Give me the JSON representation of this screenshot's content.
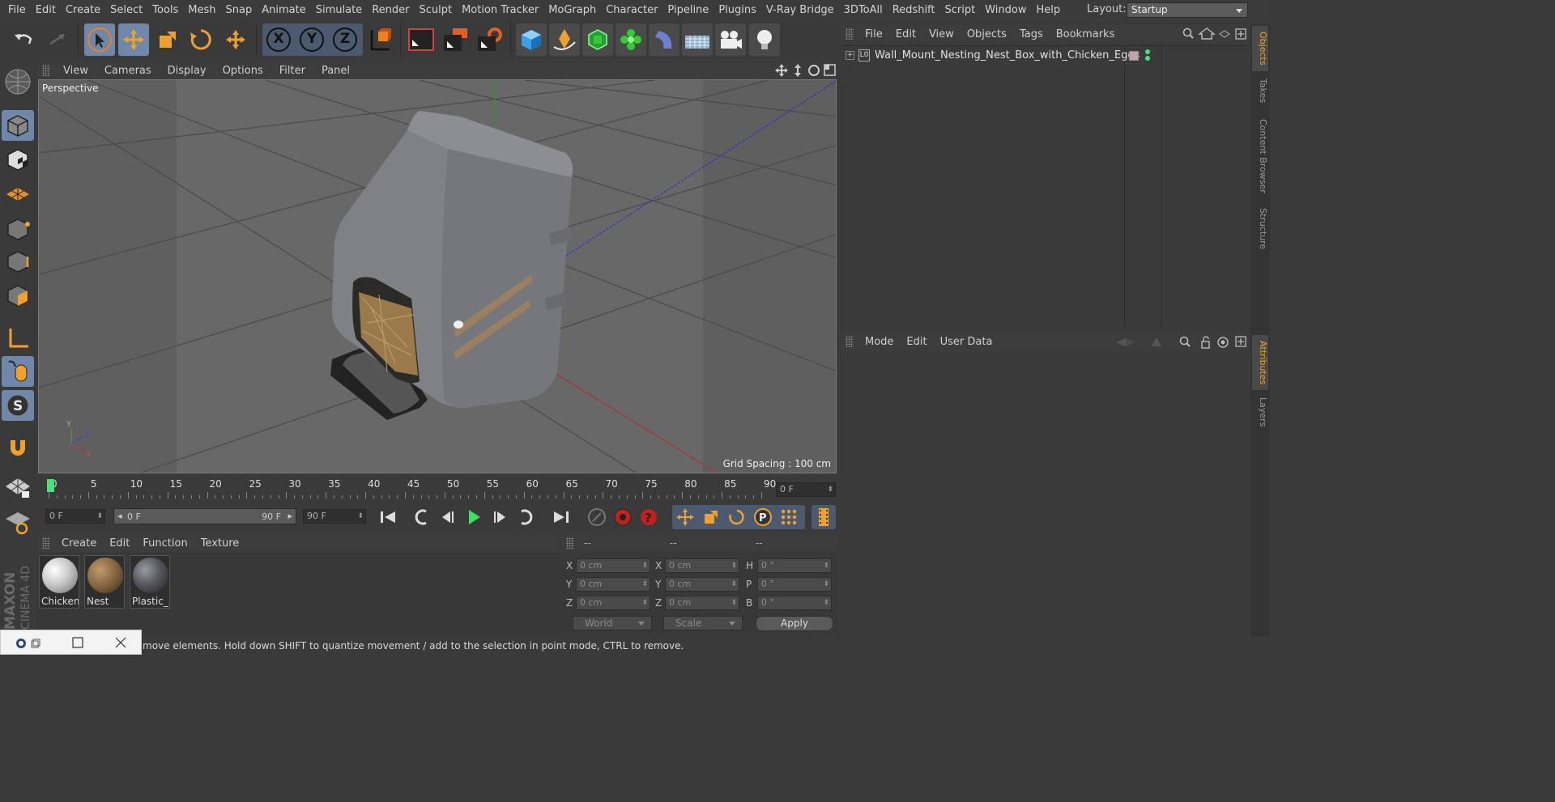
{
  "menubar": {
    "items": [
      "File",
      "Edit",
      "Create",
      "Select",
      "Tools",
      "Mesh",
      "Snap",
      "Animate",
      "Simulate",
      "Render",
      "Sculpt",
      "Motion Tracker",
      "MoGraph",
      "Character",
      "Pipeline",
      "Plugins",
      "V-Ray Bridge",
      "3DToAll",
      "Redshift",
      "Script",
      "Window",
      "Help"
    ],
    "layout_label": "Layout:",
    "layout_value": "Startup"
  },
  "toolbar": {
    "axis_x": "X",
    "axis_y": "Y",
    "axis_z": "Z"
  },
  "viewport": {
    "menu": [
      "View",
      "Cameras",
      "Display",
      "Options",
      "Filter",
      "Panel"
    ],
    "label": "Perspective",
    "grid_spacing": "Grid Spacing : 100 cm",
    "axis_x": "X",
    "axis_y": "Y",
    "axis_z": "Z"
  },
  "timeline": {
    "ticks": [
      "0",
      "5",
      "10",
      "15",
      "20",
      "25",
      "30",
      "35",
      "40",
      "45",
      "50",
      "55",
      "60",
      "65",
      "70",
      "75",
      "80",
      "85",
      "90"
    ],
    "current_frame": "0 F"
  },
  "controls": {
    "start_field": "0 F",
    "range_start": "0 F",
    "range_end": "90 F",
    "end_field": "90 F"
  },
  "materials": {
    "menu": [
      "Create",
      "Edit",
      "Function",
      "Texture"
    ],
    "items": [
      {
        "name": "Chicken",
        "color": "#d8d8d8"
      },
      {
        "name": "Nest",
        "color": "#8a6a45"
      },
      {
        "name": "Plastic_E",
        "color": "#55575c"
      }
    ]
  },
  "coords": {
    "headers": [
      "--",
      "--",
      "--"
    ],
    "pos": {
      "x": "0 cm",
      "y": "0 cm",
      "z": "0 cm"
    },
    "size": {
      "x": "0 cm",
      "y": "0 cm",
      "z": "0 cm"
    },
    "rot": {
      "h": "0 °",
      "p": "0 °",
      "b": "0 °"
    },
    "labels": {
      "x": "X",
      "y": "Y",
      "z": "Z",
      "h": "H",
      "p": "P",
      "b": "B"
    },
    "world": "World",
    "scale": "Scale",
    "apply": "Apply"
  },
  "objects": {
    "menu": [
      "File",
      "Edit",
      "View",
      "Objects",
      "Tags",
      "Bookmarks"
    ],
    "items": [
      {
        "name": "Wall_Mount_Nesting_Nest_Box_with_Chicken_Eggs",
        "layer": "L0"
      }
    ]
  },
  "attributes": {
    "menu": [
      "Mode",
      "Edit",
      "User Data"
    ]
  },
  "right_tabs": [
    "Objects",
    "Takes",
    "Content Browser",
    "Structure",
    "Attributes",
    "Layers"
  ],
  "status": {
    "text": "move elements. Hold down SHIFT to quantize movement / add to the selection in point mode, CTRL to remove."
  },
  "branding": {
    "line1": "MAXON",
    "line2": "CINEMA 4D"
  },
  "colors": {
    "accent": "#6f87a8",
    "orange": "#f0a030"
  }
}
